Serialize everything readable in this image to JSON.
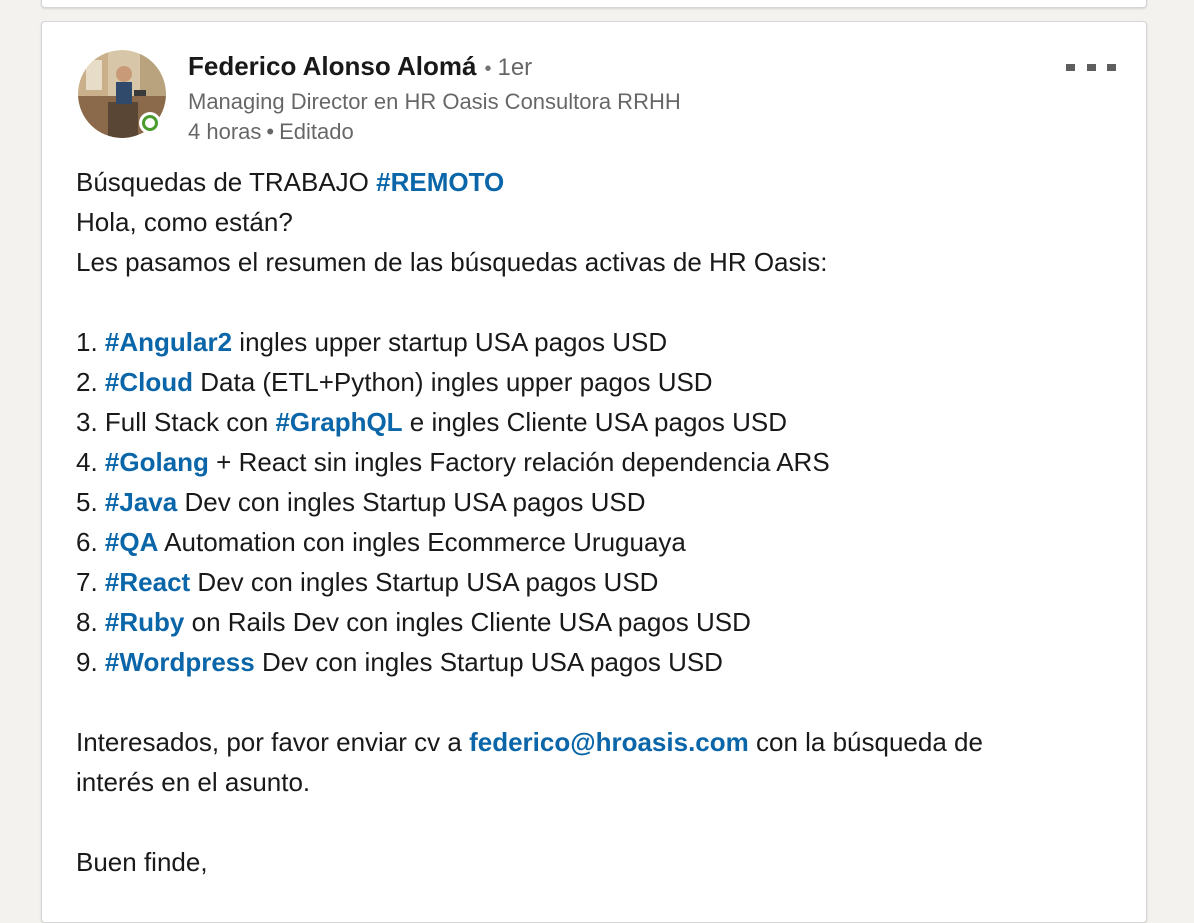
{
  "post": {
    "author": {
      "name": "Federico Alonso Alomá",
      "degree": "1er",
      "headline": "Managing Director en HR Oasis Consultora RRHH",
      "time": "4 horas",
      "edited": "Editado",
      "separator": "•"
    },
    "body": {
      "title_prefix": "Búsquedas de TRABAJO ",
      "title_hashtag": "#REMOTO",
      "greeting": "Hola, como están?",
      "intro": "Les pasamos el resumen de las búsquedas activas de HR Oasis:",
      "items": [
        {
          "num": "1. ",
          "hashtag": "#Angular2",
          "text": " ingles upper startup USA pagos USD"
        },
        {
          "num": "2. ",
          "hashtag": "#Cloud",
          "text": " Data (ETL+Python) ingles upper pagos USD"
        },
        {
          "num": "3. ",
          "before": "Full Stack con ",
          "hashtag": "#GraphQL",
          "text": " e ingles Cliente USA pagos USD"
        },
        {
          "num": "4. ",
          "hashtag": "#Golang",
          "text": " + React sin ingles Factory relación dependencia ARS"
        },
        {
          "num": "5. ",
          "hashtag": "#Java",
          "text": " Dev con ingles Startup USA pagos USD"
        },
        {
          "num": "6. ",
          "hashtag": "#QA",
          "text": " Automation con ingles Ecommerce Uruguaya"
        },
        {
          "num": "7. ",
          "hashtag": "#React",
          "text": " Dev con ingles Startup USA pagos USD"
        },
        {
          "num": "8. ",
          "hashtag": "#Ruby",
          "text": " on Rails Dev con ingles Cliente USA pagos USD"
        },
        {
          "num": "9. ",
          "hashtag": "#Wordpress",
          "text": " Dev con ingles Startup USA pagos USD"
        }
      ],
      "closing_before": "Interesados, por favor enviar cv a ",
      "email": "federico@hroasis.com",
      "closing_after": " con la búsqueda de",
      "closing_line2": "interés en el asunto.",
      "signoff": "Buen finde,"
    }
  },
  "colors": {
    "link": "#0a66a8",
    "presence": "#4a9c2d"
  },
  "icons": {
    "more": "three-dots-icon",
    "presence": "online-status-icon"
  }
}
